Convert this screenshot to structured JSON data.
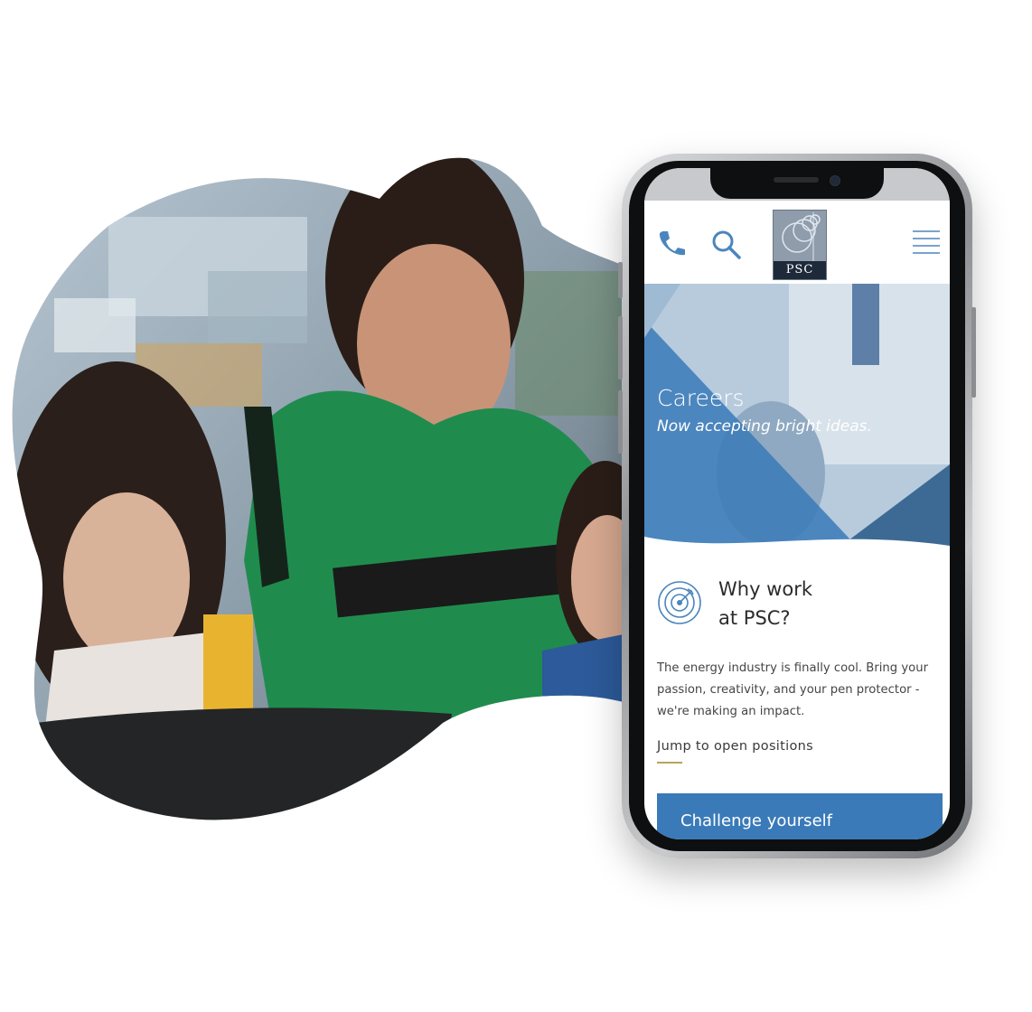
{
  "app": {
    "logo_text": "PSC"
  },
  "hero": {
    "title": "Careers",
    "subtitle": "Now accepting bright ideas."
  },
  "why": {
    "title_line1": "Why work",
    "title_line2": "at PSC?",
    "body": "The energy industry is finally cool. Bring your passion, creativity, and your pen protector - we're making an impact.",
    "link": "Jump to open positions"
  },
  "challenge": {
    "label": "Challenge yourself"
  },
  "icons": [
    "phone-icon",
    "search-icon",
    "hamburger-menu-icon",
    "target-icon"
  ],
  "colors": {
    "accent_blue": "#3a7ab8",
    "icon_blue": "#4a86bd",
    "link_underline": "#b8a35b"
  }
}
